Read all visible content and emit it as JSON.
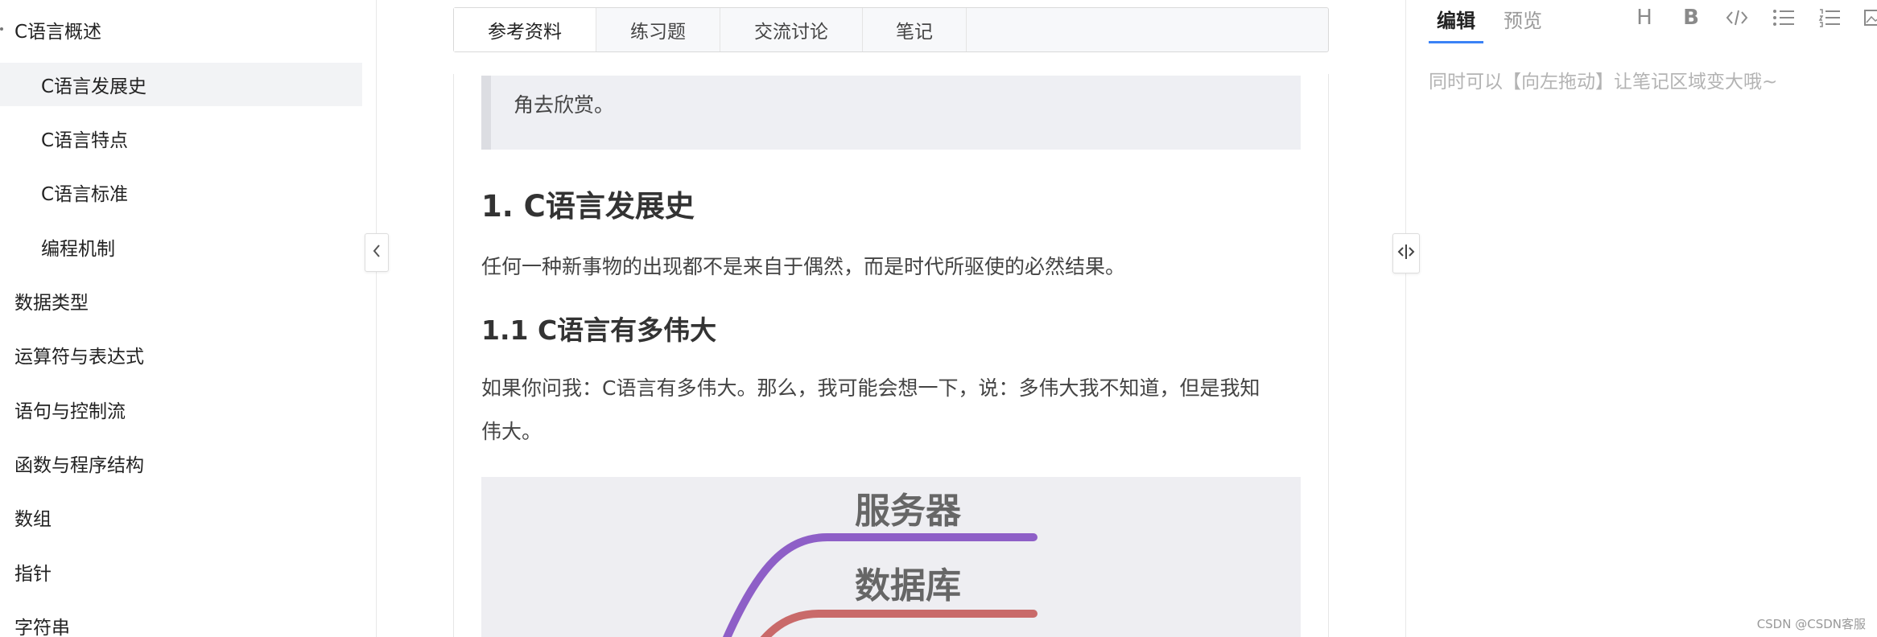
{
  "sidebar": {
    "items": [
      {
        "label": "C语言概述",
        "level": 1,
        "active": false
      },
      {
        "label": "C语言发展史",
        "level": 2,
        "active": true
      },
      {
        "label": "C语言特点",
        "level": 2,
        "active": false
      },
      {
        "label": "C语言标准",
        "level": 2,
        "active": false
      },
      {
        "label": "编程机制",
        "level": 2,
        "active": false
      },
      {
        "label": "数据类型",
        "level": 1,
        "active": false
      },
      {
        "label": "运算符与表达式",
        "level": 1,
        "active": false
      },
      {
        "label": "语句与控制流",
        "level": 1,
        "active": false
      },
      {
        "label": "函数与程序结构",
        "level": 1,
        "active": false
      },
      {
        "label": "数组",
        "level": 1,
        "active": false
      },
      {
        "label": "指针",
        "level": 1,
        "active": false
      },
      {
        "label": "字符串",
        "level": 1,
        "active": false
      }
    ],
    "collapse_icon": "chevron-left-icon"
  },
  "tabs": [
    {
      "label": "参考资料",
      "active": true
    },
    {
      "label": "练习题",
      "active": false
    },
    {
      "label": "交流讨论",
      "active": false
    },
    {
      "label": "笔记",
      "active": false
    }
  ],
  "article": {
    "quote_text": "角去欣赏。",
    "h1": "1. C语言发展史",
    "p1": "任何一种新事物的出现都不是来自于偶然，而是时代所驱使的必然结果。",
    "h2": "1.1 C语言有多伟大",
    "p2_line1": "如果你问我：C语言有多伟大。那么，我可能会想一下，说：多伟大我不知道，但是我知",
    "p2_line2": "伟大。",
    "mindmap": {
      "label1": "服务器",
      "label2": "数据库",
      "color1": "#8e5fc7",
      "color2": "#c96a6a"
    }
  },
  "splitter_icon": "resize-horizontal-icon",
  "notes": {
    "tab_edit": "编辑",
    "tab_preview": "预览",
    "toolbar": [
      "heading-icon",
      "bold-icon",
      "code-icon",
      "bullet-list-icon",
      "numbered-list-icon",
      "image-icon"
    ],
    "heading_glyph": "H",
    "bold_glyph": "B",
    "placeholder": "同时可以【向左拖动】让笔记区域变大哦~"
  },
  "watermark": "CSDN @CSDN客服",
  "colors": {
    "accent": "#3b82f6",
    "active_bg": "#f2f3f5",
    "quote_bg": "#eeeff3"
  }
}
